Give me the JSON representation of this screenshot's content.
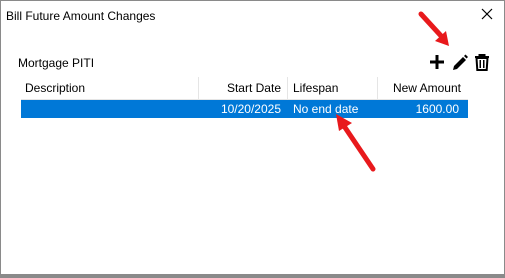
{
  "window": {
    "title": "Bill Future Amount Changes",
    "close_icon": "close-icon"
  },
  "bill": {
    "name": "Mortgage PITI"
  },
  "toolbar": {
    "icons": [
      "add-icon",
      "edit-icon",
      "delete-icon"
    ]
  },
  "table": {
    "columns": [
      "Description",
      "Start Date",
      "Lifespan",
      "New Amount"
    ],
    "rows": [
      {
        "description": "",
        "start_date": "10/20/2025",
        "lifespan": "No end date",
        "new_amount": "1600.00",
        "selected": true
      }
    ],
    "selection_color": "#0078d7"
  },
  "annotations": {
    "arrow_color": "#e8191c",
    "arrows": [
      "arrow-to-edit-icon",
      "arrow-to-lifespan-cell"
    ]
  }
}
